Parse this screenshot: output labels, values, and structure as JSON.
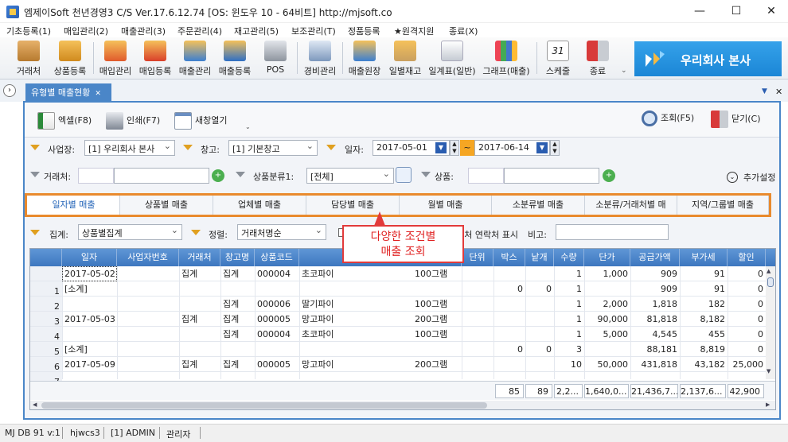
{
  "window": {
    "title": "엠제이Soft 천년경영3 C/S    Ver.17.6.12.74    [OS: 윈도우 10 - 64비트]    http://mjsoft.co",
    "minimize": "—",
    "maximize": "☐",
    "close": "✕"
  },
  "menu": [
    "기초등록(1)",
    "매입관리(2)",
    "매출관리(3)",
    "주문관리(4)",
    "재고관리(5)",
    "보조관리(T)",
    "정품등록",
    "★원격지원",
    "종료(X)"
  ],
  "toolbar": {
    "items": [
      "거래처",
      "상품등록",
      "매입관리",
      "매입등록",
      "매출관리",
      "매출등록",
      "POS",
      "경비관리",
      "매출원장",
      "일별재고",
      "일계표(일반)",
      "그래프(매출)",
      "스케줄",
      "종료"
    ],
    "more": "⌄",
    "calendar_day": "31"
  },
  "company": {
    "name": "우리회사 본사"
  },
  "doc_tab": {
    "label": "유형별 매출현황",
    "close": "✕"
  },
  "panel_controls": {
    "dropdown": "▼",
    "close": "✕",
    "expand": "›"
  },
  "inner_toolbar": {
    "excel": "엑셀(F8)",
    "print": "인쇄(F7)",
    "new_window": "새창열기",
    "search": "조회(F5)",
    "close": "닫기(C)"
  },
  "filters": {
    "business_label": "사업장:",
    "business_value": "[1] 우리회사 본사",
    "warehouse_label": "창고:",
    "warehouse_value": "[1] 기본창고",
    "date_label": "일자:",
    "date_from": "2017-05-01",
    "date_sep": "~",
    "date_to": "2017-06-14",
    "client_label": "거래처:",
    "client_value": "",
    "category_label": "상품분류1:",
    "category_value": "[전체]",
    "product_label": "상품:",
    "product_value": "",
    "more_label": "추가설정",
    "total_label": "집계:",
    "total_value": "상품별집계",
    "sort_label": "정렬:",
    "sort_value": "거래처명순",
    "contact_label": "거래처 연락처 표시",
    "memo_label": "비고:"
  },
  "tabs": [
    "일자별 매출",
    "상품별 매출",
    "업체별 매출",
    "담당별 매출",
    "월별 매출",
    "소분류별 매출",
    "소분류/거래처별 매",
    "지역/그룹별 매출"
  ],
  "callout": {
    "line1": "다양한 조건별",
    "line2": "매출 조회"
  },
  "grid": {
    "columns": [
      "일자",
      "사업자번호",
      "거래처",
      "창고명",
      "상품코드",
      "",
      "단위",
      "박스",
      "낱개",
      "수량",
      "단가",
      "공급가액",
      "부가세",
      "할인"
    ],
    "rows": [
      {
        "no": "1",
        "date": "2017-05-02",
        "biz": "",
        "client": "집계",
        "wh": "집계",
        "code": "000004",
        "name": "초코파이",
        "spec": "100그램",
        "unit": "",
        "box": "",
        "each": "",
        "qty": "1",
        "price": "1,000",
        "supply": "909",
        "vat": "91",
        "disc": "0"
      },
      {
        "no": "2",
        "date": "[소계]",
        "biz": "",
        "client": "",
        "wh": "",
        "code": "",
        "name": "",
        "spec": "",
        "unit": "",
        "box": "0",
        "each": "0",
        "qty": "1",
        "price": "",
        "supply": "909",
        "vat": "91",
        "disc": "0"
      },
      {
        "no": "3",
        "date": "",
        "biz": "",
        "client": "",
        "wh": "집계",
        "code": "000006",
        "name": "딸기파이",
        "spec": "100그램",
        "unit": "",
        "box": "",
        "each": "",
        "qty": "1",
        "price": "2,000",
        "supply": "1,818",
        "vat": "182",
        "disc": "0"
      },
      {
        "no": "4",
        "date": "2017-05-03",
        "biz": "",
        "client": "집계",
        "wh": "집계",
        "code": "000005",
        "name": "망고파이",
        "spec": "200그램",
        "unit": "",
        "box": "",
        "each": "",
        "qty": "1",
        "price": "90,000",
        "supply": "81,818",
        "vat": "8,182",
        "disc": "0"
      },
      {
        "no": "5",
        "date": "",
        "biz": "",
        "client": "",
        "wh": "집계",
        "code": "000004",
        "name": "초코파이",
        "spec": "100그램",
        "unit": "",
        "box": "",
        "each": "",
        "qty": "1",
        "price": "5,000",
        "supply": "4,545",
        "vat": "455",
        "disc": "0"
      },
      {
        "no": "6",
        "date": "[소계]",
        "biz": "",
        "client": "",
        "wh": "",
        "code": "",
        "name": "",
        "spec": "",
        "unit": "",
        "box": "0",
        "each": "0",
        "qty": "3",
        "price": "",
        "supply": "88,181",
        "vat": "8,819",
        "disc": "0"
      },
      {
        "no": "7",
        "date": "2017-05-09",
        "biz": "",
        "client": "집계",
        "wh": "집계",
        "code": "000005",
        "name": "망고파이",
        "spec": "200그램",
        "unit": "",
        "box": "",
        "each": "",
        "qty": "10",
        "price": "50,000",
        "supply": "431,818",
        "vat": "43,182",
        "disc": "25,000"
      }
    ],
    "totals": [
      "85",
      "89",
      "2,2...",
      "1,640,0...",
      "21,436,7...",
      "2,137,6...",
      "42,900"
    ]
  },
  "status": [
    "MJ DB 91 v:1",
    "hjwcs3",
    "[1] ADMIN",
    "관리자"
  ],
  "colors": {
    "accent": "#4a86c8",
    "tab_border": "#e98a2d",
    "callout": "#e23b3b",
    "banner": "#1b86d6"
  }
}
